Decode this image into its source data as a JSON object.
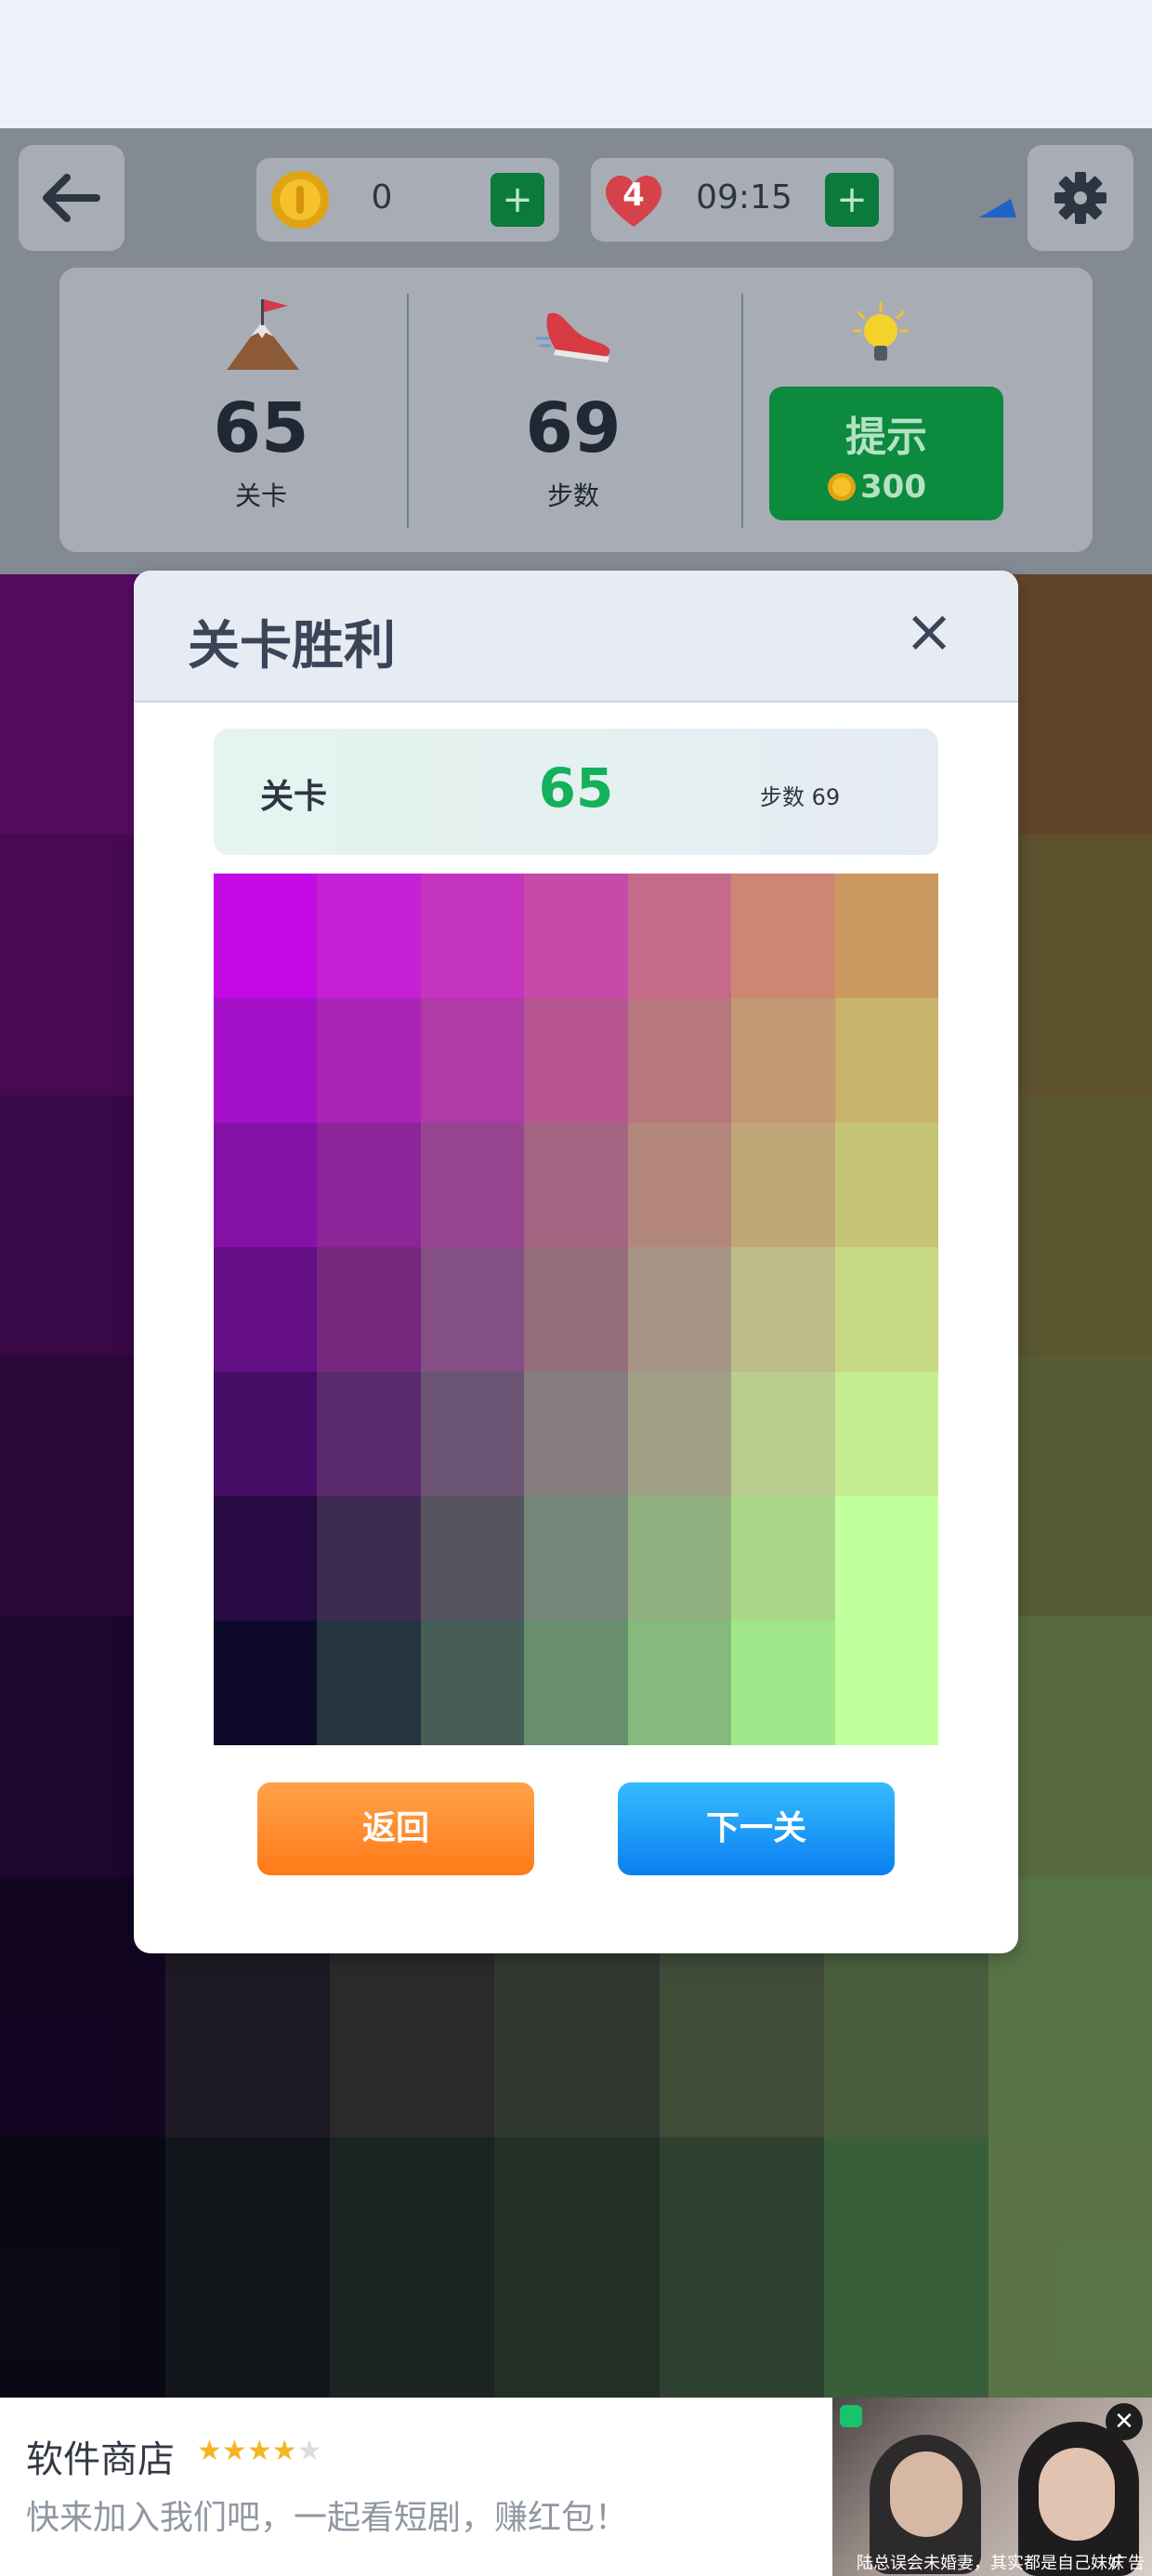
{
  "hud": {
    "coins": "0",
    "lives": "4",
    "timer": "09:15",
    "plus": "+",
    "back_icon": "arrow-left-icon",
    "settings_icon": "gear-icon"
  },
  "stats": {
    "level_value": "65",
    "level_label": "关卡",
    "steps_value": "69",
    "steps_label": "步数",
    "hint_label": "提示",
    "hint_cost": "300"
  },
  "modal": {
    "title": "关卡胜利",
    "close": "×",
    "level_label": "关卡",
    "level_value": "65",
    "steps_text": "步数 69",
    "back_button": "返回",
    "next_button": "下一关"
  },
  "result_grid": [
    [
      "#c30ae5",
      "#c321d3",
      "#c534bf",
      "#c64aa8",
      "#c66a8c",
      "#cb8771",
      "#ca9960"
    ],
    [
      "#a410c8",
      "#ab24b8",
      "#b03aa6",
      "#b75591",
      "#b8767e",
      "#c29875",
      "#c9b26b"
    ],
    [
      "#8512a6",
      "#8b2599",
      "#974491",
      "#a56582",
      "#b3867c",
      "#c1a678",
      "#c6c475"
    ],
    [
      "#640f85",
      "#76287f",
      "#834f84",
      "#946e7c",
      "#a69586",
      "#bcbd86",
      "#c7d884"
    ],
    [
      "#460c66",
      "#5a2b6c",
      "#6b5374",
      "#857c7f",
      "#a0a086",
      "#bacd8f",
      "#c6ec92"
    ],
    [
      "#260a41",
      "#3d2b52",
      "#56555f",
      "#75857a",
      "#91b07f",
      "#aad889",
      "#c2ff9d"
    ],
    [
      "#0d0a29",
      "#263341",
      "#465e56",
      "#678f6b",
      "#85ba7c",
      "#a0e78a",
      "#c2ff9d"
    ]
  ],
  "board": {
    "columns": [
      [
        "#7f138f",
        "#6a0f7c",
        "#540d6a",
        "#420c57",
        "#2c0b44",
        "#1b0932",
        "#0f0d1f"
      ],
      [
        "#7a1e8a",
        "#6b237b",
        "#5c2b6b",
        "#4a285d",
        "#3b2746",
        "#2e2838",
        "#1c2129"
      ],
      [
        "#7a2d86",
        "#6e3577",
        "#683f6c",
        "#5d4563",
        "#514d55",
        "#3f3e42",
        "#293734"
      ],
      [
        "#804178",
        "#78476f",
        "#70516a",
        "#6a6068",
        "#5f6a5b",
        "#4a5449",
        "#324739"
      ],
      [
        "#8a5270",
        "#85616b",
        "#7f6f69",
        "#7b7c63",
        "#707e5f",
        "#5f7254",
        "#466249"
      ],
      [
        "#906563",
        "#8f775e",
        "#8d845b",
        "#898d59",
        "#7f9859",
        "#6c8c5b",
        "#548c57"
      ],
      [
        "#91663f",
        "#8b7a45",
        "#858148",
        "#83894e",
        "#84a05d",
        "#82ad6a",
        "#86ae6c"
      ]
    ]
  },
  "ad": {
    "store_name": "软件商店",
    "rating": 4,
    "subtitle": "快来加入我们吧，一起看短剧，赚红包！",
    "caption": "陆总误会未婚妻，其实都是自己妹妹",
    "close": "✕",
    "badge": "广告"
  }
}
